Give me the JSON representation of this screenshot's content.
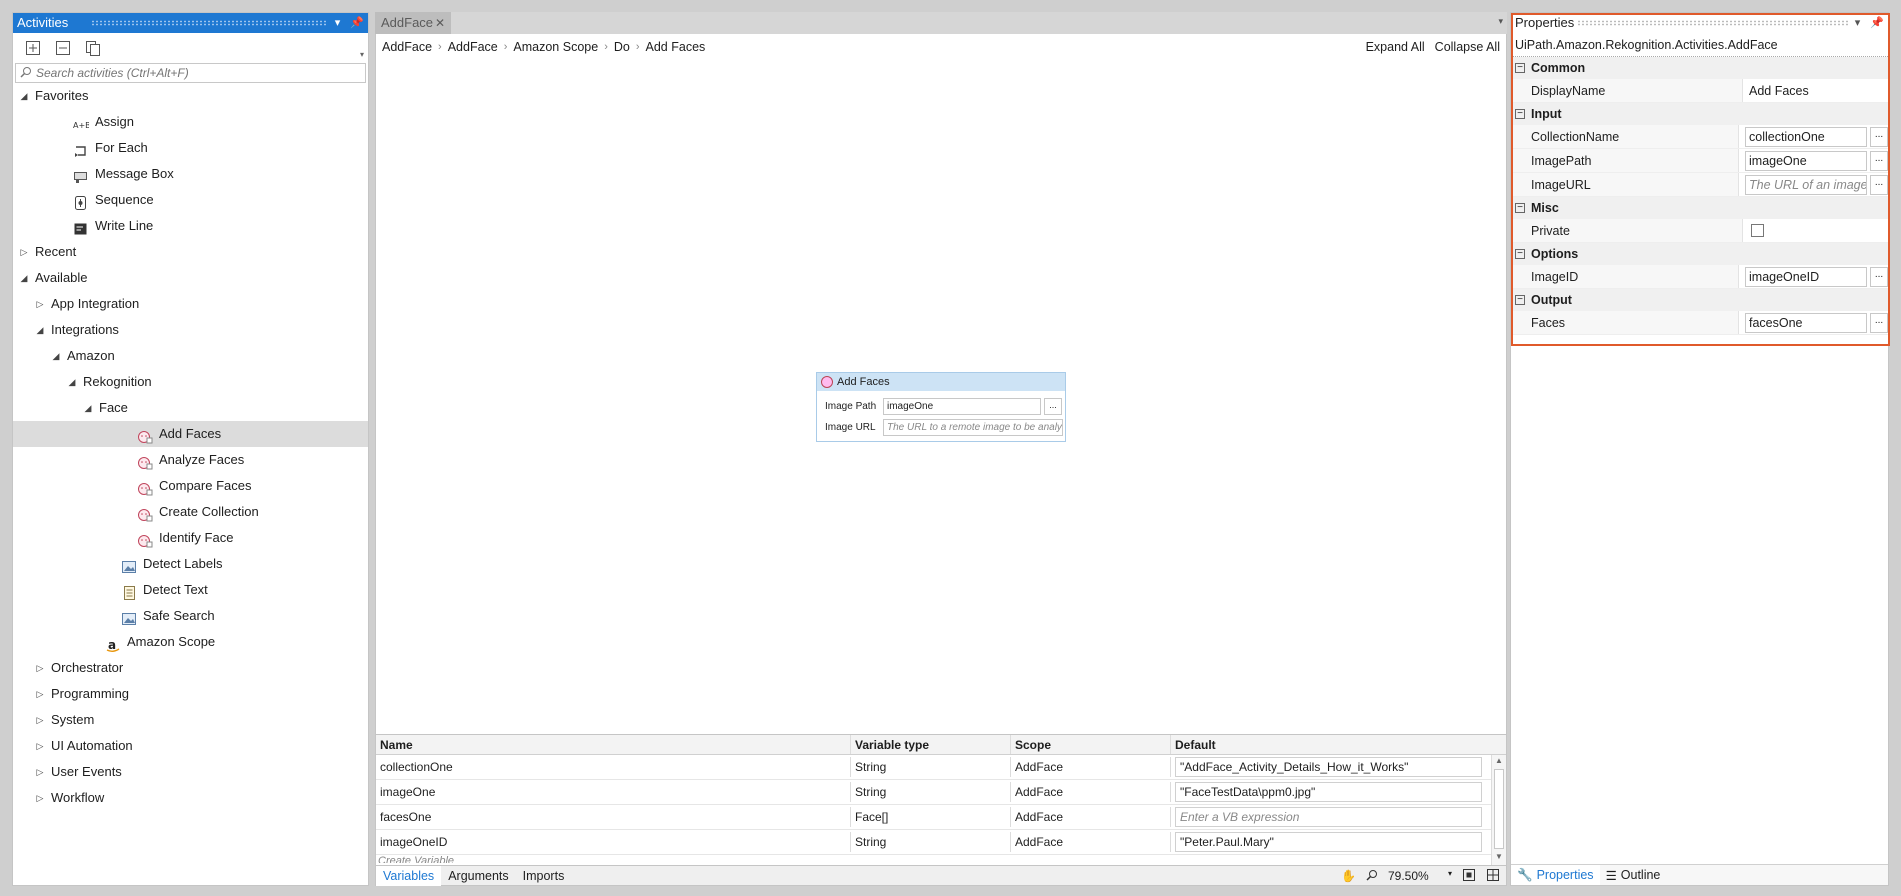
{
  "activities": {
    "title": "Activities",
    "search_placeholder": "Search activities (Ctrl+Alt+F)",
    "tree": [
      {
        "label": "Favorites",
        "level": 0,
        "expanded": true,
        "icon": ""
      },
      {
        "label": "Assign",
        "level": 2,
        "icon": "assign-icon"
      },
      {
        "label": "For Each",
        "level": 2,
        "icon": "for-each-icon"
      },
      {
        "label": "Message Box",
        "level": 2,
        "icon": "message-box-icon"
      },
      {
        "label": "Sequence",
        "level": 2,
        "icon": "sequence-icon"
      },
      {
        "label": "Write Line",
        "level": 2,
        "icon": "write-line-icon"
      },
      {
        "label": "Recent",
        "level": 0,
        "expanded": false,
        "icon": ""
      },
      {
        "label": "Available",
        "level": 0,
        "expanded": true,
        "icon": ""
      },
      {
        "label": "App Integration",
        "level": 1,
        "expanded": false,
        "icon": ""
      },
      {
        "label": "Integrations",
        "level": 1,
        "expanded": true,
        "icon": ""
      },
      {
        "label": "Amazon",
        "level": 2,
        "expanded": true,
        "icon": ""
      },
      {
        "label": "Rekognition",
        "level": 3,
        "expanded": true,
        "icon": ""
      },
      {
        "label": "Face",
        "level": 4,
        "expanded": true,
        "icon": ""
      },
      {
        "label": "Add Faces",
        "level": 6,
        "icon": "face-icon",
        "selected": true
      },
      {
        "label": "Analyze Faces",
        "level": 6,
        "icon": "face-icon"
      },
      {
        "label": "Compare Faces",
        "level": 6,
        "icon": "face-icon"
      },
      {
        "label": "Create Collection",
        "level": 6,
        "icon": "face-icon"
      },
      {
        "label": "Identify Face",
        "level": 6,
        "icon": "face-icon"
      },
      {
        "label": "Detect Labels",
        "level": 5,
        "icon": "image-icon"
      },
      {
        "label": "Detect Text",
        "level": 5,
        "icon": "document-icon"
      },
      {
        "label": "Safe Search",
        "level": 5,
        "icon": "image-icon"
      },
      {
        "label": "Amazon Scope",
        "level": 4,
        "icon": "amazon-icon"
      },
      {
        "label": "Orchestrator",
        "level": 1,
        "expanded": false,
        "icon": ""
      },
      {
        "label": "Programming",
        "level": 1,
        "expanded": false,
        "icon": ""
      },
      {
        "label": "System",
        "level": 1,
        "expanded": false,
        "icon": ""
      },
      {
        "label": "UI Automation",
        "level": 1,
        "expanded": false,
        "icon": ""
      },
      {
        "label": "User Events",
        "level": 1,
        "expanded": false,
        "icon": ""
      },
      {
        "label": "Workflow",
        "level": 1,
        "expanded": false,
        "icon": ""
      }
    ]
  },
  "designer": {
    "tab_label": "AddFace",
    "breadcrumb": [
      "AddFace",
      "AddFace",
      "Amazon Scope",
      "Do",
      "Add Faces"
    ],
    "expand_all": "Expand All",
    "collapse_all": "Collapse All",
    "activity": {
      "title": "Add Faces",
      "image_path_label": "Image Path",
      "image_path_value": "imageOne",
      "image_url_label": "Image URL",
      "image_url_placeholder": "The URL to a remote image to be analysed",
      "dots": "..."
    },
    "variables": {
      "headers": [
        "Name",
        "Variable type",
        "Scope",
        "Default"
      ],
      "rows": [
        {
          "name": "collectionOne",
          "type": "String",
          "scope": "AddFace",
          "default": "\"AddFace_Activity_Details_How_it_Works\"",
          "placeholder": false
        },
        {
          "name": "imageOne",
          "type": "String",
          "scope": "AddFace",
          "default": "\"FaceTestData\\ppm0.jpg\"",
          "placeholder": false
        },
        {
          "name": "facesOne",
          "type": "Face[]",
          "scope": "AddFace",
          "default": "Enter a VB expression",
          "placeholder": true
        },
        {
          "name": "imageOneID",
          "type": "String",
          "scope": "AddFace",
          "default": "\"Peter.Paul.Mary\"",
          "placeholder": false
        }
      ],
      "create_variable": "Create Variable"
    },
    "bottom_tabs": [
      "Variables",
      "Arguments",
      "Imports"
    ],
    "zoom": "79.50%"
  },
  "properties": {
    "title": "Properties",
    "type_name": "UiPath.Amazon.Rekognition.Activities.AddFace",
    "dots": "...",
    "categories": {
      "common": "Common",
      "input": "Input",
      "misc": "Misc",
      "options": "Options",
      "output": "Output"
    },
    "rows": {
      "display_name": {
        "label": "DisplayName",
        "value": "Add Faces"
      },
      "collection_name": {
        "label": "CollectionName",
        "value": "collectionOne"
      },
      "image_path": {
        "label": "ImagePath",
        "value": "imageOne"
      },
      "image_url": {
        "label": "ImageURL",
        "value": "The URL of an image"
      },
      "private": {
        "label": "Private",
        "checked": false
      },
      "image_id": {
        "label": "ImageID",
        "value": "imageOneID"
      },
      "faces": {
        "label": "Faces",
        "value": "facesOne"
      }
    },
    "bottom_tabs": [
      "Properties",
      "Outline"
    ]
  },
  "colors": {
    "accent": "#1e78d2",
    "highlight": "#e05a2b"
  }
}
